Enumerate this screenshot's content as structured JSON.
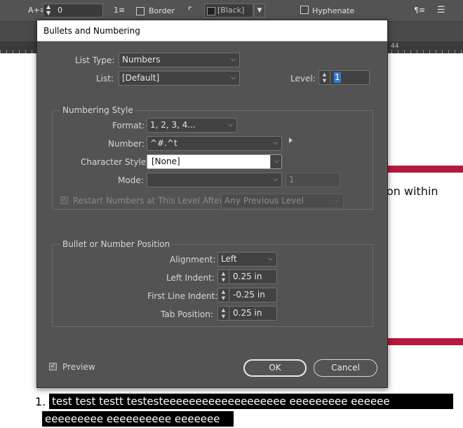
{
  "toolbar": {
    "icon_label": "A+≡",
    "spacing_value": "0",
    "icon_numbered": "1≡",
    "border_label": "Border",
    "color_value": "[Black]",
    "hyphenate_label": "Hyphenate",
    "para_icon": "¶≡",
    "align_icon": "☰"
  },
  "ruler": {
    "mark": "44"
  },
  "background": {
    "partial_text": "on within",
    "list_number": "1.",
    "selected_line1": "test  test  testt  testesteeeeeeeeeeeeeeeeeee  eeeeeeeee  eeeeee",
    "selected_line2": "eeeeeeeee eeeeeeeeee eeeeeee",
    "accent_color": "#b51a3d"
  },
  "dialog": {
    "title": "Bullets and Numbering",
    "list_type_label": "List Type:",
    "list_type_value": "Numbers",
    "list_label": "List:",
    "list_value": "[Default]",
    "level_label": "Level:",
    "level_value": "1",
    "numbering_style": {
      "title": "Numbering Style",
      "format_label": "Format:",
      "format_value": "1, 2, 3, 4...",
      "number_label": "Number:",
      "number_value": "^#.^t",
      "char_style_label": "Character Style:",
      "char_style_value": "[None]",
      "mode_label": "Mode:",
      "mode_value": "",
      "mode_number": "1",
      "restart_label": "Restart Numbers at This Level After:",
      "restart_value": "Any Previous Level"
    },
    "position": {
      "title": "Bullet or Number Position",
      "alignment_label": "Alignment:",
      "alignment_value": "Left",
      "left_indent_label": "Left Indent:",
      "left_indent_value": "0.25 in",
      "first_line_label": "First Line Indent:",
      "first_line_value": "-0.25 in",
      "tab_position_label": "Tab Position:",
      "tab_position_value": "0.25 in"
    },
    "preview_label": "Preview",
    "ok_label": "OK",
    "cancel_label": "Cancel"
  }
}
